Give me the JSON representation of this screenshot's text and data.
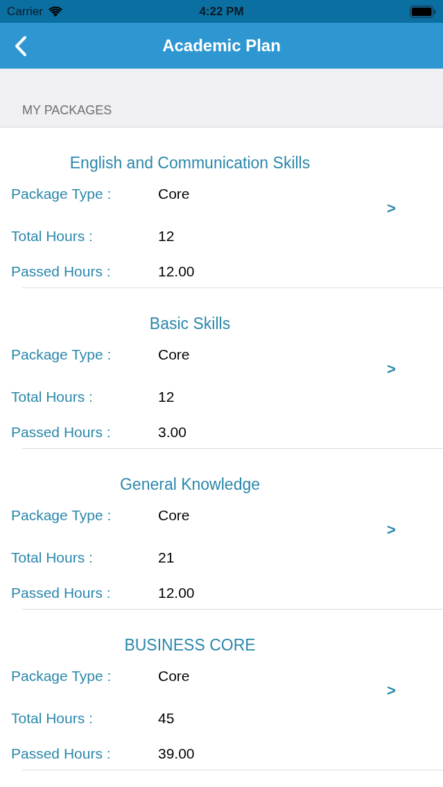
{
  "status_bar": {
    "carrier": "Carrier",
    "time": "4:22 PM"
  },
  "nav_bar": {
    "title": "Academic Plan"
  },
  "section_header": "MY PACKAGES",
  "packages": [
    {
      "title": "English and Communication Skills",
      "chevron": ">",
      "fields": [
        {
          "label": "Package Type :",
          "value": "Core"
        },
        {
          "label": "Total Hours :",
          "value": "12"
        },
        {
          "label": "Passed Hours :",
          "value": "12.00"
        }
      ]
    },
    {
      "title": "Basic Skills",
      "chevron": ">",
      "fields": [
        {
          "label": "Package Type :",
          "value": "Core"
        },
        {
          "label": "Total Hours :",
          "value": "12"
        },
        {
          "label": "Passed Hours :",
          "value": "3.00"
        }
      ]
    },
    {
      "title": "General Knowledge",
      "chevron": ">",
      "fields": [
        {
          "label": "Package Type :",
          "value": "Core"
        },
        {
          "label": "Total Hours :",
          "value": "21"
        },
        {
          "label": "Passed Hours :",
          "value": "12.00"
        }
      ]
    },
    {
      "title": "BUSINESS CORE",
      "chevron": ">",
      "fields": [
        {
          "label": "Package Type :",
          "value": "Core"
        },
        {
          "label": "Total Hours :",
          "value": "45"
        },
        {
          "label": "Passed Hours :",
          "value": "39.00"
        }
      ]
    }
  ]
}
